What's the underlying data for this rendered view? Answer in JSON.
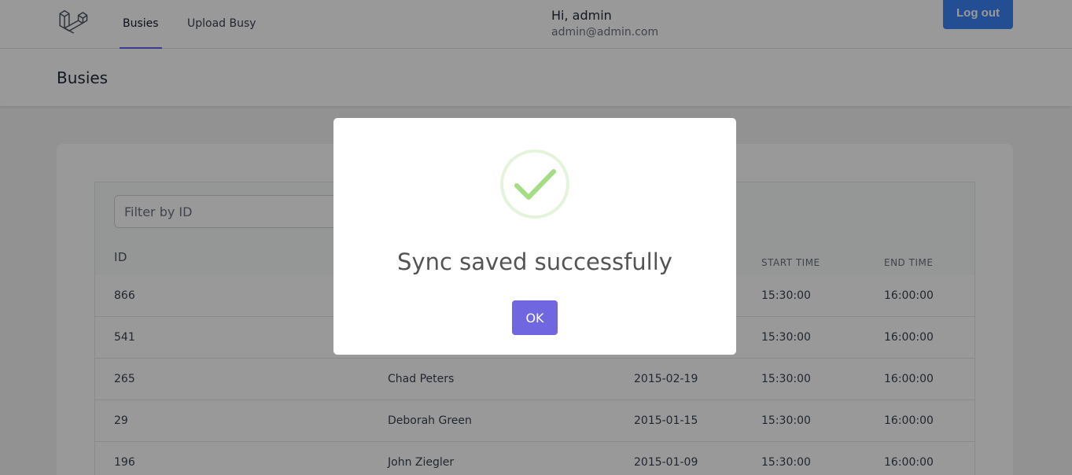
{
  "nav": {
    "links": [
      "Busies",
      "Upload Busy"
    ],
    "greeting": "Hi, admin",
    "email": "admin@admin.com",
    "logout_label": "Log out"
  },
  "header": {
    "title": "Busies"
  },
  "table": {
    "filter_placeholder": "Filter by ID",
    "columns": [
      "ID",
      "START TIME",
      "END TIME"
    ],
    "rows": [
      {
        "id": "866",
        "name": "",
        "date": "",
        "start": "15:30:00",
        "end": "16:00:00"
      },
      {
        "id": "541",
        "name": "",
        "date": "",
        "start": "15:30:00",
        "end": "16:00:00"
      },
      {
        "id": "265",
        "name": "Chad Peters",
        "date": "2015-02-19",
        "start": "15:30:00",
        "end": "16:00:00"
      },
      {
        "id": "29",
        "name": "Deborah Green",
        "date": "2015-01-15",
        "start": "15:30:00",
        "end": "16:00:00"
      },
      {
        "id": "196",
        "name": "John Ziegler",
        "date": "2015-01-09",
        "start": "15:30:00",
        "end": "16:00:00"
      }
    ]
  },
  "modal": {
    "title": "Sync saved successfully",
    "ok_label": "OK",
    "icon": "check-icon",
    "accent_color": "#a5dc86",
    "button_color": "#7066e0"
  },
  "colors": {
    "primary": "#3b82f6",
    "nav_active": "#6366f1"
  }
}
